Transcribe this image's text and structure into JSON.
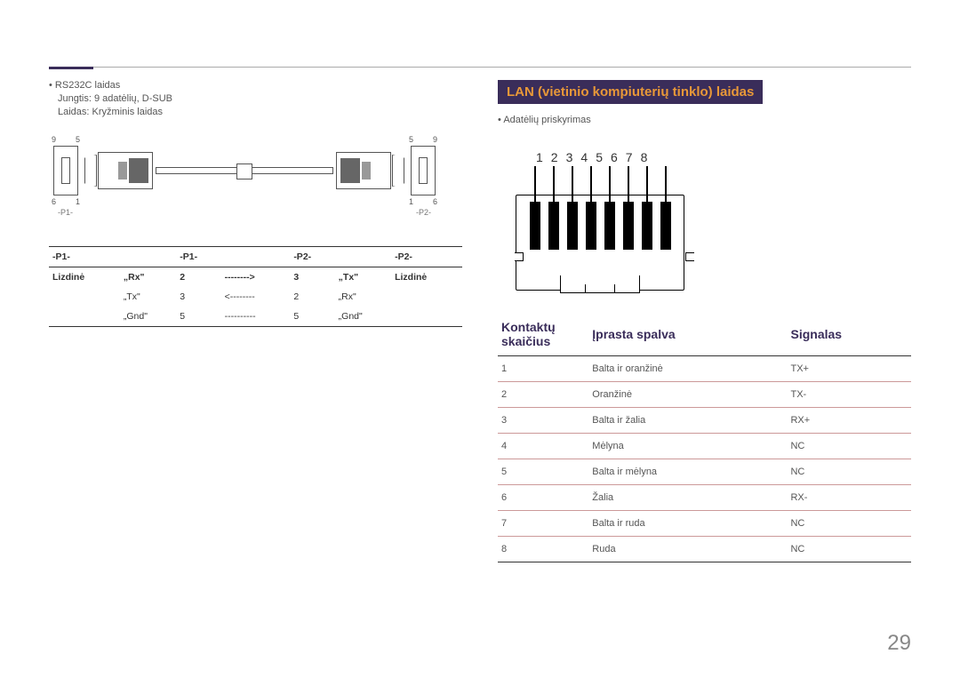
{
  "left": {
    "bullet_main": "RS232C laidas",
    "bullet_sub1": "Jungtis: 9 adatėlių, D-SUB",
    "bullet_sub2": "Laidas: Kryžminis laidas",
    "diagram": {
      "tl": "9",
      "tr": "5",
      "bl": "6",
      "br": "1",
      "tl2": "5",
      "tr2": "9",
      "bl2": "1",
      "br2": "6",
      "p1": "-P1-",
      "p2": "-P2-"
    },
    "table": {
      "headers": [
        "-P1-",
        "",
        "-P1-",
        "",
        "-P2-",
        "",
        "-P2-"
      ],
      "rows": [
        [
          "Lizdinė",
          "„Rx\"",
          "2",
          "-------->",
          "3",
          "„Tx\"",
          "Lizdinė"
        ],
        [
          "",
          "„Tx\"",
          "3",
          "<--------",
          "2",
          "„Rx\"",
          ""
        ],
        [
          "",
          "„Gnd\"",
          "5",
          "----------",
          "5",
          "„Gnd\"",
          ""
        ]
      ]
    }
  },
  "right": {
    "header": "LAN (vietinio kompiuterių tinklo) laidas",
    "bullet": "Adatėlių priskyrimas",
    "pins": [
      "1",
      "2",
      "3",
      "4",
      "5",
      "6",
      "7",
      "8"
    ],
    "table": {
      "h1": "Kontaktų skaičius",
      "h2": "Įprasta spalva",
      "h3": "Signalas",
      "rows": [
        [
          "1",
          "Balta ir oranžinė",
          "TX+"
        ],
        [
          "2",
          "Oranžinė",
          "TX-"
        ],
        [
          "3",
          "Balta ir žalia",
          "RX+"
        ],
        [
          "4",
          "Mėlyna",
          "NC"
        ],
        [
          "5",
          "Balta ir mėlyna",
          "NC"
        ],
        [
          "6",
          "Žalia",
          "RX-"
        ],
        [
          "7",
          "Balta ir ruda",
          "NC"
        ],
        [
          "8",
          "Ruda",
          "NC"
        ]
      ]
    }
  },
  "page": "29"
}
